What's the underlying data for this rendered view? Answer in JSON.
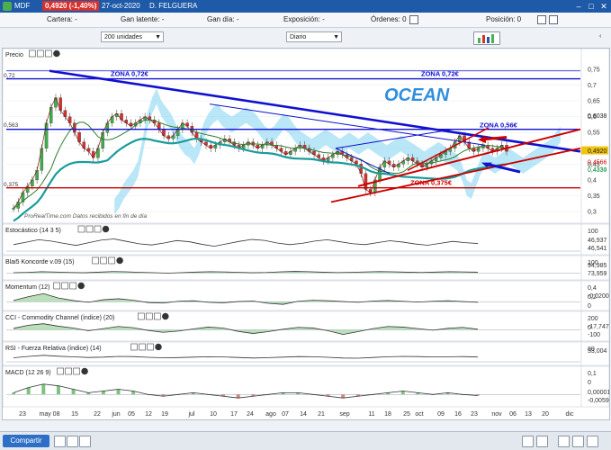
{
  "window": {
    "ticker": "MDF",
    "price_badge": "0,4920 (-1,40%)",
    "date": "27-oct-2020",
    "owner": "D. FELGUERA",
    "controls": [
      "–",
      "□",
      "✕"
    ]
  },
  "infobar": {
    "cartera": "Cartera: -",
    "ganancia_latente": "Gan latente: -",
    "ganancia_dia": "Gan día: -",
    "exposicion": "Exposición: -",
    "ordenes": "Órdenes: 0",
    "posicion": "Posición: 0"
  },
  "controls": {
    "quantity": "200 unidades",
    "period": "Diario"
  },
  "colors": {
    "accent": "#1e5aa8",
    "zone_blue": "#1010d0",
    "zone_red": "#cc0000",
    "ichimoku": "#7fd3f0",
    "ma_teal": "#1a9b9b"
  },
  "chart_data": [
    {
      "type": "line",
      "panel": "Precio",
      "title": "Precio",
      "annotation": "OCEAN",
      "source_note": "ProRealTime.com  Datos recibidos en fin de día",
      "y_ticks": [
        "0,75",
        "0,7",
        "0,65",
        "0,6",
        "0,55",
        "0,5",
        "0,45",
        "0,4",
        "0,35",
        "0,3"
      ],
      "ylim": [
        0.28,
        0.77
      ],
      "zones": [
        {
          "label": "ZONA 0,72€",
          "value": 0.72,
          "color": "#1010d0"
        },
        {
          "label": "ZONA 0,72€",
          "value": 0.72,
          "color": "#1010d0"
        },
        {
          "label": "ZONA 0,56€",
          "value": 0.56,
          "color": "#1010d0"
        },
        {
          "label": "ZONA 0,375€",
          "value": 0.375,
          "color": "#cc0000"
        }
      ],
      "left_labels": [
        "0,72",
        "0,563",
        "0,375"
      ],
      "right_labels": [
        {
          "text": "0,6038",
          "value": 0.6038
        },
        {
          "text": "0,4920",
          "value": 0.492,
          "badge": "#f1c40f"
        },
        {
          "text": "0,4566",
          "value": 0.4566,
          "color": "#cc0000"
        },
        {
          "text": "0,4330",
          "value": 0.433,
          "color": "#1a9b9b"
        },
        {
          "text": "0,4334",
          "value": 0.4334,
          "color": "#4cae4c"
        }
      ],
      "series": [
        {
          "values": [
            0.31,
            0.33,
            0.36,
            0.38,
            0.4,
            0.43,
            0.5,
            0.58,
            0.63,
            0.66,
            0.62,
            0.6,
            0.58,
            0.55,
            0.52,
            0.5,
            0.49,
            0.47,
            0.5,
            0.55,
            0.58,
            0.6,
            0.61,
            0.59,
            0.58,
            0.57,
            0.58,
            0.59,
            0.6,
            0.59,
            0.58,
            0.56,
            0.54,
            0.53,
            0.54,
            0.56,
            0.58,
            0.57,
            0.55,
            0.53,
            0.52,
            0.51,
            0.5,
            0.51,
            0.52,
            0.53,
            0.52,
            0.51,
            0.5,
            0.51,
            0.52,
            0.51,
            0.5,
            0.51,
            0.52,
            0.51,
            0.5,
            0.49,
            0.48,
            0.49,
            0.5,
            0.51,
            0.5,
            0.49,
            0.48,
            0.47,
            0.46,
            0.47,
            0.48,
            0.49,
            0.48,
            0.47,
            0.46,
            0.45,
            0.42,
            0.37,
            0.36,
            0.4,
            0.44,
            0.46,
            0.45,
            0.44,
            0.45,
            0.46,
            0.47,
            0.46,
            0.45,
            0.44,
            0.45,
            0.46,
            0.47,
            0.48,
            0.49,
            0.5,
            0.52,
            0.54,
            0.52,
            0.5,
            0.49,
            0.5,
            0.51,
            0.5,
            0.49,
            0.5,
            0.51,
            0.49
          ],
          "color": "#222222"
        }
      ]
    },
    {
      "type": "line",
      "panel": "Estocástico",
      "title": "Estocástico (14 3 5)",
      "y_ticks": [
        "100"
      ],
      "right_labels": [
        "46,937",
        "46,541"
      ],
      "ylim": [
        0,
        100
      ],
      "series": [
        {
          "values": [
            40,
            55,
            70,
            62,
            48,
            35,
            52,
            68,
            75,
            60,
            45,
            38,
            50,
            65,
            58,
            42,
            30,
            45,
            60,
            72,
            66,
            50,
            40,
            48,
            62,
            70,
            58,
            46,
            40,
            52,
            64,
            56,
            44,
            36,
            48,
            60,
            52,
            47
          ]
        }
      ]
    },
    {
      "type": "area",
      "panel": "Blai5 Koncorde",
      "title": "Blai5 Koncorde v.09 (15)",
      "y_ticks": [
        "100"
      ],
      "right_labels": [
        "94,985",
        "73,959"
      ],
      "ylim": [
        -50,
        100
      ],
      "series": [
        {
          "values": [
            5,
            10,
            20,
            15,
            8,
            4,
            12,
            22,
            18,
            10,
            5,
            -2,
            6,
            14,
            20,
            16,
            10,
            4,
            8,
            18,
            24,
            20,
            12,
            6,
            10,
            16,
            22,
            18,
            12,
            8,
            14,
            20,
            16,
            12
          ]
        }
      ]
    },
    {
      "type": "area",
      "panel": "Momentum",
      "title": "Momentum (12)",
      "y_ticks": [
        "0,4",
        "0,2",
        "0"
      ],
      "right_labels": [
        "-0,0200"
      ],
      "ylim": [
        -0.2,
        0.4
      ],
      "series": [
        {
          "values": [
            0.05,
            0.2,
            0.32,
            0.15,
            0.05,
            -0.02,
            0.08,
            0.12,
            0.06,
            -0.03,
            -0.05,
            0.02,
            0.04,
            -0.02,
            -0.04,
            0.01,
            0.03,
            -0.06,
            -0.1,
            0.02,
            0.06,
            0.04,
            0.01,
            -0.02,
            0.03,
            0.05,
            0.02,
            -0.01,
            0.02,
            0.04,
            0.01,
            -0.02
          ]
        }
      ]
    },
    {
      "type": "area",
      "panel": "CCI",
      "title": "CCI - Commodity Channel (índice) (20)",
      "y_ticks": [
        "200",
        "0"
      ],
      "right_labels": [
        "-17,747",
        "-100"
      ],
      "ylim": [
        -250,
        250
      ],
      "series": [
        {
          "values": [
            50,
            150,
            200,
            120,
            60,
            -30,
            40,
            110,
            70,
            -20,
            -80,
            -40,
            30,
            90,
            60,
            -50,
            -120,
            -60,
            20,
            80,
            60,
            -30,
            -150,
            -60,
            40,
            110,
            90,
            40,
            -10,
            50,
            80,
            20
          ]
        }
      ]
    },
    {
      "type": "line",
      "panel": "RSI",
      "title": "RSI - Fuerza Relativa (índice) (14)",
      "y_ticks": [
        "80"
      ],
      "right_labels": [
        "53,004"
      ],
      "ylim": [
        0,
        100
      ],
      "series": [
        {
          "values": [
            45,
            60,
            72,
            62,
            55,
            48,
            52,
            60,
            58,
            50,
            45,
            47,
            52,
            56,
            54,
            48,
            42,
            46,
            52,
            58,
            56,
            50,
            42,
            40,
            48,
            56,
            60,
            58,
            54,
            56,
            58,
            53
          ]
        }
      ]
    },
    {
      "type": "bar",
      "panel": "MACD",
      "title": "MACD (12 26 9)",
      "y_ticks": [
        "0,1",
        "0"
      ],
      "right_labels": [
        "0,00001",
        "-0,0059"
      ],
      "ylim": [
        -0.05,
        0.1
      ],
      "series": [
        {
          "values": [
            0.01,
            0.04,
            0.06,
            0.05,
            0.03,
            0.01,
            0.02,
            0.03,
            0.02,
            0.0,
            -0.01,
            0.0,
            0.01,
            0.0,
            -0.01,
            -0.02,
            -0.01,
            0.0,
            0.01,
            0.01,
            0.0,
            -0.01,
            -0.02,
            -0.01,
            0.0,
            0.01,
            0.02,
            0.01,
            0.0,
            0.01,
            0.0,
            -0.006
          ]
        }
      ]
    }
  ],
  "x_axis": {
    "labels": [
      "23",
      "may 08",
      "15",
      "22",
      "jun",
      "05",
      "12",
      "19",
      "jul",
      "10",
      "17",
      "24",
      "ago",
      "07",
      "14",
      "21",
      "sep",
      "11",
      "18",
      "25",
      "oct",
      "09",
      "16",
      "23",
      "nov",
      "06",
      "13",
      "20",
      "dic"
    ]
  },
  "bottombar": {
    "share_button": "Compartir"
  }
}
